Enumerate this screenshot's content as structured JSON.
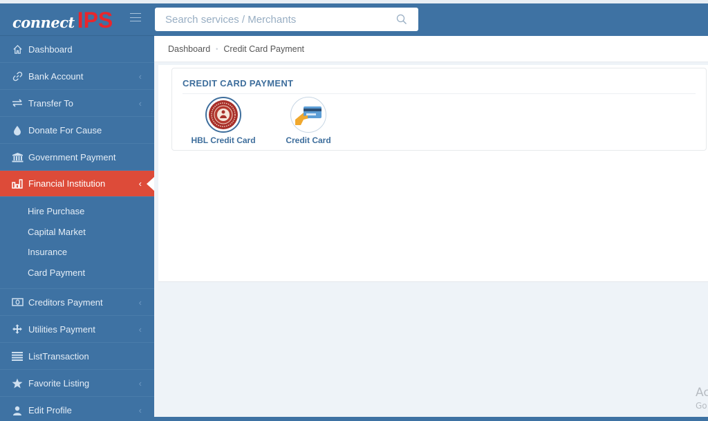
{
  "app": {
    "logo_left": "connect",
    "logo_right": "IPS"
  },
  "sidebar": {
    "items": [
      {
        "label": "Dashboard",
        "icon": "home-icon",
        "has_chevron": false
      },
      {
        "label": "Bank Account",
        "icon": "link-icon",
        "has_chevron": true
      },
      {
        "label": "Transfer To",
        "icon": "transfer-icon",
        "has_chevron": true
      },
      {
        "label": "Donate For Cause",
        "icon": "drop-icon",
        "has_chevron": false
      },
      {
        "label": "Government Payment",
        "icon": "bank-building-icon",
        "has_chevron": false
      },
      {
        "label": "Financial Institution",
        "icon": "bar-chart-icon",
        "has_chevron": true,
        "active": true
      },
      {
        "label": "Creditors Payment",
        "icon": "money-icon",
        "has_chevron": true
      },
      {
        "label": "Utilities Payment",
        "icon": "arrows-move-icon",
        "has_chevron": true
      },
      {
        "label": "ListTransaction",
        "icon": "list-icon",
        "has_chevron": false
      },
      {
        "label": "Favorite Listing",
        "icon": "star-icon",
        "has_chevron": true
      },
      {
        "label": "Edit Profile",
        "icon": "user-icon",
        "has_chevron": true
      }
    ],
    "submenu": [
      "Hire Purchase",
      "Capital Market",
      "Insurance",
      "Card Payment"
    ],
    "chevron": "‹"
  },
  "search": {
    "placeholder": "Search services / Merchants",
    "value": ""
  },
  "breadcrumb": {
    "items": [
      "Dashboard",
      "Credit Card Payment"
    ],
    "separator": "•"
  },
  "panel": {
    "title": "CREDIT CARD PAYMENT",
    "tiles": [
      {
        "label": "HBL Credit Card",
        "icon": "hbl-logo-icon"
      },
      {
        "label": "Credit Card",
        "icon": "credit-card-hand-icon"
      }
    ]
  },
  "watermark": {
    "line1": "Ac",
    "line2": "Go"
  },
  "colors": {
    "sidebar": "#3e72a3",
    "active": "#dd4b39",
    "accent_text": "#3e6e9c",
    "logo_red": "#e8262c"
  }
}
